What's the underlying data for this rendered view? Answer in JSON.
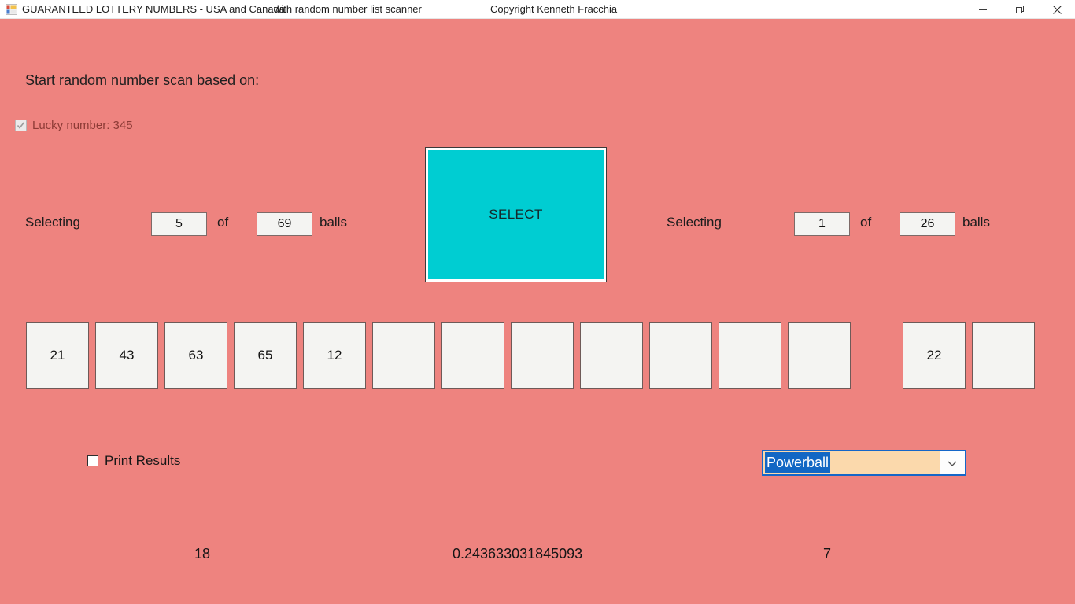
{
  "window": {
    "title_main": "GUARANTEED LOTTERY NUMBERS - USA and Canada",
    "title_sub": "with random number list scanner",
    "title_copyright": "Copyright Kenneth Fracchia",
    "app_icon": "form-icon",
    "controls": {
      "minimize": "minimize-icon",
      "maximize": "restore-icon",
      "close": "close-icon"
    },
    "background_color": "#ee837f",
    "titlebar_color": "#ffffff"
  },
  "main": {
    "heading": "Start random number scan based on:",
    "lucky": {
      "label": "Lucky number: 345",
      "checked": true,
      "text_color": "#8d3b36"
    },
    "primary_pool": {
      "selecting_label": "Selecting",
      "count_value": "5",
      "of_label": "of",
      "total_value": "69",
      "balls_label": "balls"
    },
    "bonus_pool": {
      "selecting_label": "Selecting",
      "count_value": "1",
      "of_label": "of",
      "total_value": "26",
      "balls_label": "balls"
    },
    "select_button": {
      "label": "SELECT",
      "color": "#00cdd2"
    },
    "main_numbers": [
      "21",
      "43",
      "63",
      "65",
      "12",
      "",
      "",
      "",
      "",
      "",
      "",
      ""
    ],
    "bonus_numbers": [
      "22",
      ""
    ],
    "print_results": {
      "label": "Print Results",
      "checked": false
    },
    "game_select": {
      "value": "Powerball",
      "options": [
        "Powerball"
      ],
      "highlight_color": "#1267c4",
      "field_color": "#fbd9ac"
    },
    "status": {
      "left_value": "18",
      "center_value": "0.243633031845093",
      "right_value": "7"
    }
  }
}
